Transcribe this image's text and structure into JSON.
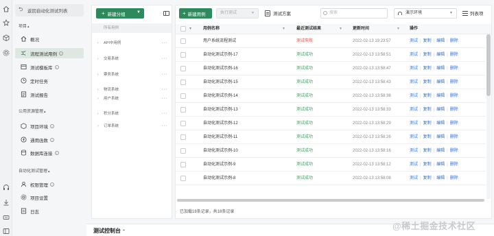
{
  "sidebar": {
    "back_label": "返回自动化测试列表",
    "sections": [
      {
        "title": "项目"
      },
      {
        "title": "公用资源管理"
      },
      {
        "title": "自动化测试管理"
      }
    ],
    "items": [
      {
        "label": "概况",
        "icon": "home-icon"
      },
      {
        "label": "流程测试用例",
        "icon": "flow-icon",
        "active": true,
        "info": true
      },
      {
        "label": "测试模板库",
        "icon": "template-icon",
        "info": true
      },
      {
        "label": "定时任务",
        "icon": "clock-icon"
      },
      {
        "label": "测试报告",
        "icon": "report-icon"
      },
      {
        "label": "项目环境",
        "icon": "environment-icon",
        "info": true
      },
      {
        "label": "通用函数",
        "icon": "function-icon",
        "info": true
      },
      {
        "label": "数据库连接",
        "icon": "database-icon",
        "info": true
      },
      {
        "label": "权限管理",
        "icon": "permission-icon",
        "info": true
      },
      {
        "label": "项目设置",
        "icon": "settings-icon"
      },
      {
        "label": "日志",
        "icon": "log-icon"
      }
    ]
  },
  "tree": {
    "new_group_label": "新建分组",
    "root_label": "所有用例",
    "nodes": [
      {
        "name": "API中用例"
      },
      {
        "name": "交易系统"
      },
      {
        "name": "票务系统"
      },
      {
        "name": "物流系统"
      },
      {
        "name": "用户系统"
      },
      {
        "name": "积分系统"
      },
      {
        "name": "订单系统"
      }
    ]
  },
  "toolbar": {
    "new_case_label": "新建用例",
    "execute_label": "执行测试",
    "plan_label": "测试方案",
    "search_placeholder": "搜索",
    "env_label": "演示环境",
    "columns_label": "列表项"
  },
  "table": {
    "columns": [
      "用例名称",
      "最近测试结果",
      "更新时间",
      "操作"
    ],
    "actions": [
      "测试",
      "复制",
      "编辑",
      "删除"
    ],
    "rows": [
      {
        "name": "用户系统流程测试",
        "status": "测试失败",
        "status_type": "fail",
        "time": "2022-02-13 19:23:57"
      },
      {
        "name": "自动化测试示例-17",
        "status": "测试成功",
        "status_type": "ok",
        "time": "2022-02-13 13:58:51"
      },
      {
        "name": "自动化测试示例-16",
        "status": "测试成功",
        "status_type": "ok",
        "time": "2022-02-13 13:58:47"
      },
      {
        "name": "自动化测试示例-15",
        "status": "测试成功",
        "status_type": "ok",
        "time": "2022-02-13 13:58:43"
      },
      {
        "name": "自动化测试示例-14",
        "status": "测试成功",
        "status_type": "ok",
        "time": "2022-02-13 13:58:38"
      },
      {
        "name": "自动化测试示例-13",
        "status": "测试成功",
        "status_type": "ok",
        "time": "2022-02-13 13:58:33"
      },
      {
        "name": "自动化测试示例-12",
        "status": "测试成功",
        "status_type": "ok",
        "time": "2022-02-13 13:58:29"
      },
      {
        "name": "自动化测试示例-11",
        "status": "测试成功",
        "status_type": "ok",
        "time": "2022-02-13 13:58:26"
      },
      {
        "name": "自动化测试示例-10",
        "status": "测试成功",
        "status_type": "ok",
        "time": "2022-02-13 13:58:16"
      },
      {
        "name": "自动化测试示例-9",
        "status": "测试成功",
        "status_type": "ok",
        "time": "2022-02-13 13:58:12"
      },
      {
        "name": "自动化测试示例-8",
        "status": "测试成功",
        "status_type": "ok",
        "time": "2022-02-13 13:58:08"
      }
    ],
    "footer": "已加载18条记录，共18条记录"
  },
  "console": {
    "title": "测试控制台"
  },
  "watermark": "@稀土掘金技术社区",
  "colors": {
    "brand": "#2e8a5d",
    "link": "#2d6fd2",
    "fail": "#e04d44",
    "success": "#37a05c"
  }
}
